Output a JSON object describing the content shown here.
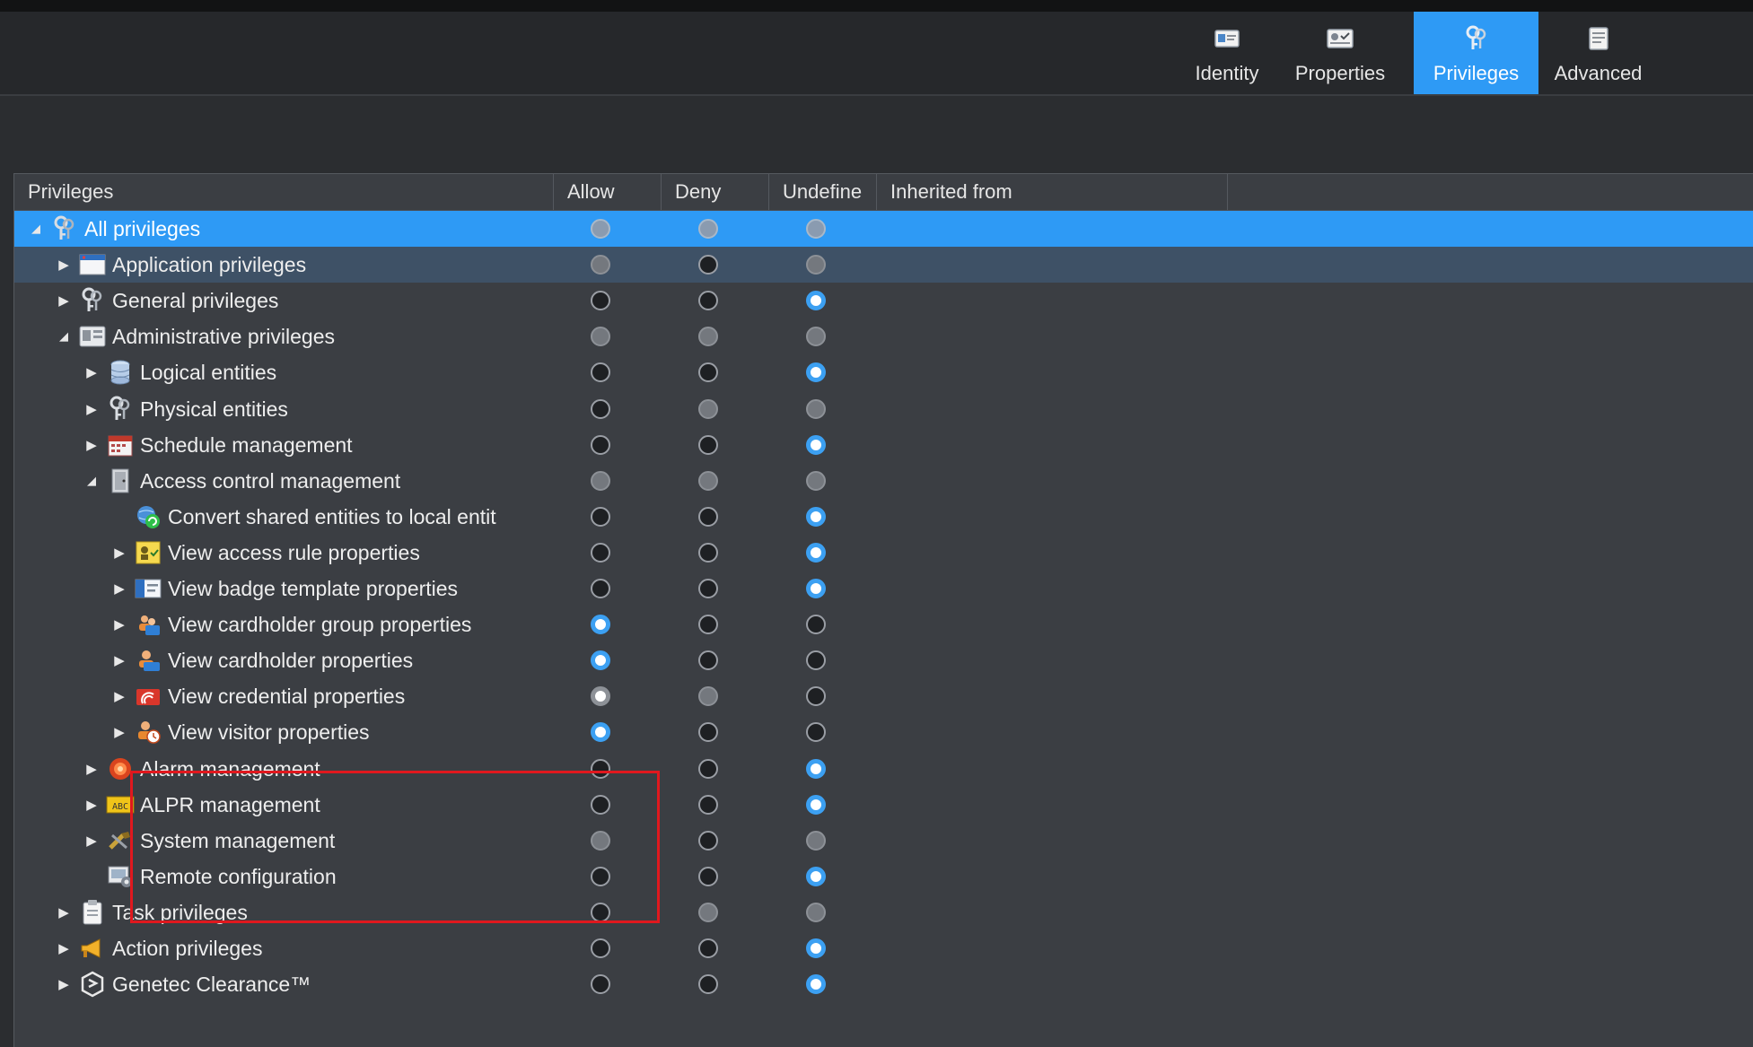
{
  "tabs": [
    {
      "label": "Identity",
      "icon": "identity-card-icon",
      "active": false
    },
    {
      "label": "Properties",
      "icon": "properties-icon",
      "active": false
    },
    {
      "label": "Privileges",
      "icon": "privileges-keys-icon",
      "active": true
    },
    {
      "label": "Advanced",
      "icon": "advanced-icon",
      "active": false
    }
  ],
  "columns": {
    "privileges": "Privileges",
    "allow": "Allow",
    "deny": "Deny",
    "undefine": "Undefine",
    "inherited_from": "Inherited from"
  },
  "rows": [
    {
      "label": "All privileges",
      "icon": "keys-icon",
      "expanded": true,
      "allow": "grey",
      "deny": "grey",
      "undefine": "grey",
      "selected": true
    },
    {
      "label": "Application privileges",
      "icon": "application-window-icon",
      "expanded": false,
      "allow": "grey",
      "deny": "off",
      "undefine": "grey"
    },
    {
      "label": "General privileges",
      "icon": "keys-icon",
      "expanded": false,
      "allow": "off",
      "deny": "off",
      "undefine": "on"
    },
    {
      "label": "Administrative privileges",
      "icon": "admin-console-icon",
      "expanded": true,
      "allow": "grey",
      "deny": "grey",
      "undefine": "grey"
    },
    {
      "label": "Logical entities",
      "icon": "database-icon",
      "expanded": false,
      "allow": "off",
      "deny": "off",
      "undefine": "on"
    },
    {
      "label": "Physical entities",
      "icon": "keys-icon",
      "expanded": false,
      "allow": "off",
      "deny": "grey",
      "undefine": "grey"
    },
    {
      "label": "Schedule management",
      "icon": "calendar-icon",
      "expanded": false,
      "allow": "off",
      "deny": "off",
      "undefine": "on"
    },
    {
      "label": "Access control management",
      "icon": "door-icon",
      "expanded": true,
      "allow": "grey",
      "deny": "grey",
      "undefine": "grey"
    },
    {
      "label": "Convert shared entities to local entit",
      "icon": "convert-globe-icon",
      "expanded": null,
      "allow": "off",
      "deny": "off",
      "undefine": "on"
    },
    {
      "label": "View access rule properties",
      "icon": "access-rule-icon",
      "expanded": false,
      "allow": "off",
      "deny": "off",
      "undefine": "on"
    },
    {
      "label": "View badge template properties",
      "icon": "badge-template-icon",
      "expanded": false,
      "allow": "off",
      "deny": "off",
      "undefine": "on"
    },
    {
      "label": "View cardholder group properties",
      "icon": "cardholder-group-icon",
      "expanded": false,
      "allow": "on",
      "deny": "off",
      "undefine": "off"
    },
    {
      "label": "View cardholder properties",
      "icon": "cardholder-icon",
      "expanded": false,
      "allow": "on",
      "deny": "off",
      "undefine": "off"
    },
    {
      "label": "View credential properties",
      "icon": "credential-icon",
      "expanded": false,
      "allow": "ongrey",
      "deny": "grey",
      "undefine": "off"
    },
    {
      "label": "View visitor properties",
      "icon": "visitor-icon",
      "expanded": false,
      "allow": "on",
      "deny": "off",
      "undefine": "off"
    },
    {
      "label": "Alarm management",
      "icon": "alarm-icon",
      "expanded": false,
      "allow": "off",
      "deny": "off",
      "undefine": "on"
    },
    {
      "label": "ALPR management",
      "icon": "license-plate-icon",
      "expanded": false,
      "allow": "off",
      "deny": "off",
      "undefine": "on"
    },
    {
      "label": "System management",
      "icon": "tools-icon",
      "expanded": false,
      "allow": "grey",
      "deny": "off",
      "undefine": "grey"
    },
    {
      "label": "Remote configuration",
      "icon": "remote-config-icon",
      "expanded": null,
      "allow": "off",
      "deny": "off",
      "undefine": "on"
    },
    {
      "label": "Task privileges",
      "icon": "clipboard-icon",
      "expanded": false,
      "allow": "off",
      "deny": "grey",
      "undefine": "grey"
    },
    {
      "label": "Action privileges",
      "icon": "megaphone-icon",
      "expanded": false,
      "allow": "off",
      "deny": "off",
      "undefine": "on"
    },
    {
      "label": "Genetec Clearance™",
      "icon": "genetec-clearance-icon",
      "expanded": false,
      "allow": "off",
      "deny": "off",
      "undefine": "on"
    }
  ]
}
